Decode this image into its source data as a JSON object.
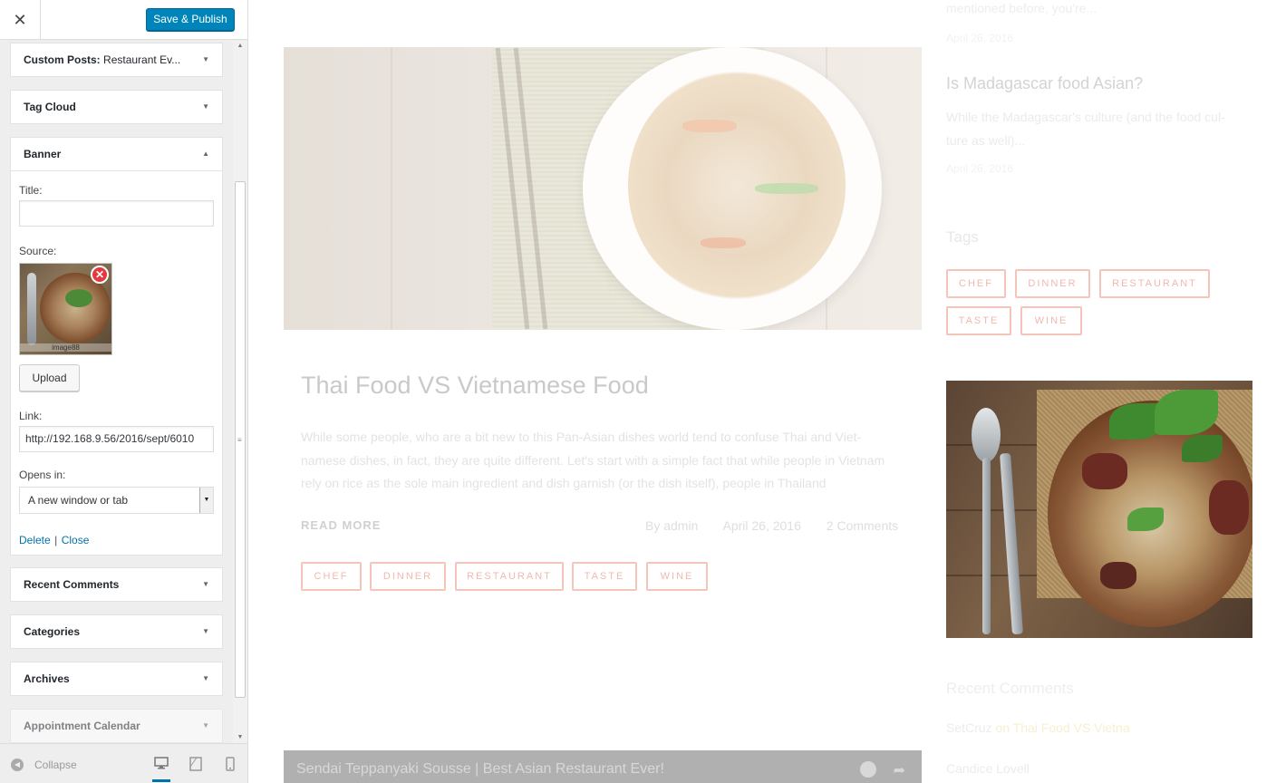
{
  "header": {
    "close_label": "✕",
    "publish_label": "Save & Publish"
  },
  "widgets": {
    "custom_posts": {
      "label": "Custom Posts:",
      "sub": "Restaurant Ev..."
    },
    "tag_cloud": {
      "label": "Tag Cloud"
    },
    "banner": {
      "label": "Banner",
      "title_label": "Title:",
      "title_value": "",
      "source_label": "Source:",
      "image_caption": "image88",
      "upload_label": "Upload",
      "link_label": "Link:",
      "link_value": "http://192.168.9.56/2016/sept/6010",
      "opens_in_label": "Opens in:",
      "opens_in_value": "A new window or tab",
      "delete_label": "Delete",
      "separator": "|",
      "close_label": "Close"
    },
    "recent_comments": {
      "label": "Recent Comments"
    },
    "categories": {
      "label": "Categories"
    },
    "archives": {
      "label": "Archives"
    },
    "appointment_calendar": {
      "label": "Appointment Calendar"
    }
  },
  "footer": {
    "collapse_label": "Collapse"
  },
  "preview": {
    "post": {
      "title": "Thai Food VS Vietnamese Food",
      "excerpt": "While some people, who are a bit new to this Pan-Asian dishes world tend to confuse Thai and Viet- namese dishes, in fact, they are quite different. Let's start with a simple fact that while people in Vietnam rely on rice as the sole main ingredient and dish garnish (or the dish itself), people in Thailand",
      "read_more": "READ MORE",
      "author": "By admin",
      "date": "April 26, 2016",
      "comments": "2 Comments",
      "tags": [
        "CHEF",
        "DINNER",
        "RESTAURANT",
        "TASTE",
        "WINE"
      ]
    },
    "sidebar": {
      "prev_excerpt_end": "mentioned before, you're...",
      "prev_date": "April 26, 2016",
      "post_title": "Is Madagascar food Asian?",
      "post_excerpt": "While the Madagascar's culture (and the food cul- ture as well)...",
      "post_date": "April 26, 2016",
      "tags_heading": "Tags",
      "tags": [
        "CHEF",
        "DINNER",
        "RESTAURANT",
        "TASTE",
        "WINE"
      ],
      "recent_comments_heading": "Recent Comments",
      "comment1_author": "SetCruz",
      "comment1_on": "on Thai Food VS Vietna",
      "comment2_author": "Candice Lovell"
    },
    "video_title": "Sendai Teppanyaki Sousse | Best Asian Restaurant Ever!"
  },
  "colors": {
    "primary_button": "#0085ba",
    "link": "#0073aa",
    "tag_border": "#f5c5bb",
    "remove_icon": "#e4373e"
  },
  "icons": [
    "close-icon",
    "chevron-down-icon",
    "chevron-up-icon",
    "remove-image-icon",
    "collapse-icon",
    "desktop-icon",
    "tablet-icon",
    "mobile-icon",
    "clock-icon",
    "share-icon"
  ]
}
